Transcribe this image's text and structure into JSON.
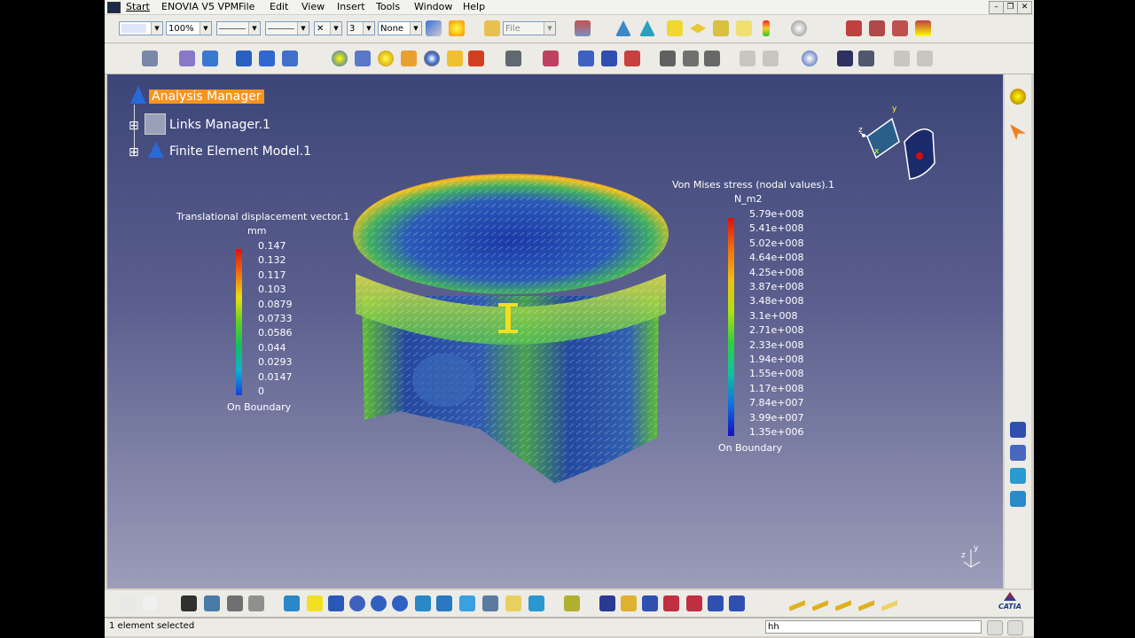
{
  "menu": {
    "start": "Start",
    "enovia": "ENOVIA V5 VPM",
    "file": "File",
    "edit": "Edit",
    "view": "View",
    "insert": "Insert",
    "tools": "Tools",
    "window": "Window",
    "help": "Help"
  },
  "toolbar": {
    "zoom_value": "100%",
    "layer_value": "None",
    "file_field": "File",
    "number_value": "3"
  },
  "tree": {
    "root": "Analysis Manager",
    "child1": "Links Manager.1",
    "child2": "Finite Element Model.1"
  },
  "legend_disp": {
    "title": "Translational displacement vector.1",
    "unit": "mm",
    "values": [
      "0.147",
      "0.132",
      "0.117",
      "0.103",
      "0.0879",
      "0.0733",
      "0.0586",
      "0.044",
      "0.0293",
      "0.0147",
      "0"
    ],
    "footer": "On Boundary"
  },
  "legend_vm": {
    "title": "Von Mises stress (nodal values).1",
    "unit": "N_m2",
    "values": [
      "5.79e+008",
      "5.41e+008",
      "5.02e+008",
      "4.64e+008",
      "4.25e+008",
      "3.87e+008",
      "3.48e+008",
      "3.1e+008",
      "2.71e+008",
      "2.33e+008",
      "1.94e+008",
      "1.55e+008",
      "1.17e+008",
      "7.84e+007",
      "3.99e+007",
      "1.35e+006"
    ],
    "footer": "On Boundary"
  },
  "axis": {
    "x": "x",
    "y": "y",
    "z": "z"
  },
  "status": {
    "selection": "1 element selected",
    "command": "hh"
  },
  "brand": "CATIA",
  "colors": {
    "viewport_top": "#3d4578",
    "viewport_bottom": "#9c9db9",
    "highlight": "#f7941d"
  }
}
